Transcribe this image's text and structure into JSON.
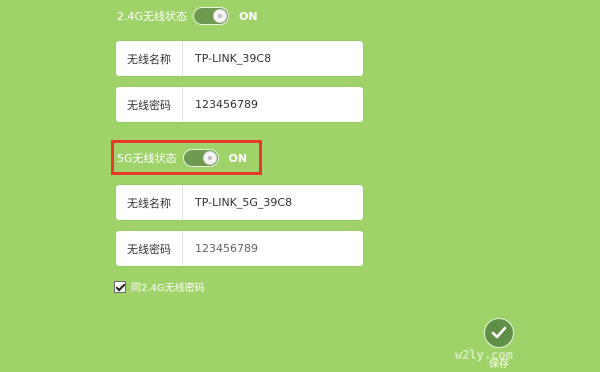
{
  "band24": {
    "status_label": "2.4G无线状态",
    "status_value": "ON",
    "name_label": "无线名称",
    "name_value": "TP-LINK_39C8",
    "password_label": "无线密码",
    "password_value": "123456789"
  },
  "band5": {
    "status_label": "5G无线状态",
    "status_value": "ON",
    "name_label": "无线名称",
    "name_value": "TP-LINK_5G_39C8",
    "password_label": "无线密码",
    "password_value": "123456789"
  },
  "same_password": {
    "label": "同2.4G无线密码",
    "checked": true
  },
  "save_label": "保存",
  "watermark": "w2ly.com",
  "colors": {
    "background": "#9fd36a",
    "toggle_on": "#6f9a52",
    "highlight": "#e8372d"
  }
}
